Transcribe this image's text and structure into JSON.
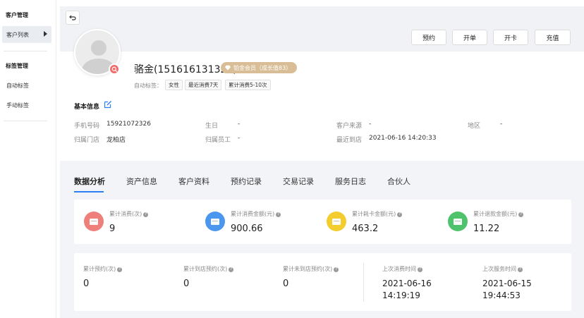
{
  "sidebar": {
    "groups": [
      {
        "title": "客户管理",
        "items": [
          {
            "label": "客户列表"
          }
        ]
      },
      {
        "title": "标签管理",
        "items": [
          {
            "label": "自动标签"
          },
          {
            "label": "手动标签"
          }
        ]
      }
    ]
  },
  "header": {
    "actions": [
      {
        "label": "预约"
      },
      {
        "label": "开单"
      },
      {
        "label": "开卡"
      },
      {
        "label": "充值"
      }
    ]
  },
  "customer": {
    "name": "骆金(151616131320)",
    "member_badge": "铂金会员（成长值83）",
    "auto_tags_label": "自动标签：",
    "tags": [
      "女性",
      "最近消费7天",
      "累计消费5-10次"
    ]
  },
  "basic_info": {
    "title": "基本信息",
    "fields": [
      {
        "label": "手机号码",
        "value": "15921072326"
      },
      {
        "label": "生日",
        "value": "-"
      },
      {
        "label": "客户来源",
        "value": "-"
      },
      {
        "label": "地区",
        "value": "-"
      },
      {
        "label": "归属门店",
        "value": "龙柏店"
      },
      {
        "label": "归属员工",
        "value": "-"
      },
      {
        "label": "最近到店",
        "value": "2021-06-16 14:20:33"
      }
    ]
  },
  "tabs": [
    "数据分析",
    "资产信息",
    "客户资料",
    "预约记录",
    "交易记录",
    "服务日志",
    "合伙人"
  ],
  "stats_row1": [
    {
      "label": "累计消费(次)",
      "value": "9",
      "color": "#ef7f7a"
    },
    {
      "label": "累计消费金额(元)",
      "value": "900.66",
      "color": "#4b97ef"
    },
    {
      "label": "累计耗卡金额(元)",
      "value": "463.2",
      "color": "#f3cd2e"
    },
    {
      "label": "累计退款金额(元)",
      "value": "11.22",
      "color": "#4fc36b"
    }
  ],
  "stats_row2": [
    {
      "label": "累计预约(次)",
      "value": "0"
    },
    {
      "label": "累计到店预约(次)",
      "value": "0"
    },
    {
      "label": "累计未到店预约(次)",
      "value": "0"
    },
    {
      "label": "上次消费时间",
      "value": "2021-06-16\n14:19:19"
    },
    {
      "label": "上次服务时间",
      "value": "2021-06-15\n19:44:53"
    }
  ],
  "colors": {
    "accent": "#2d7df6",
    "badge": "#d8bd97"
  }
}
